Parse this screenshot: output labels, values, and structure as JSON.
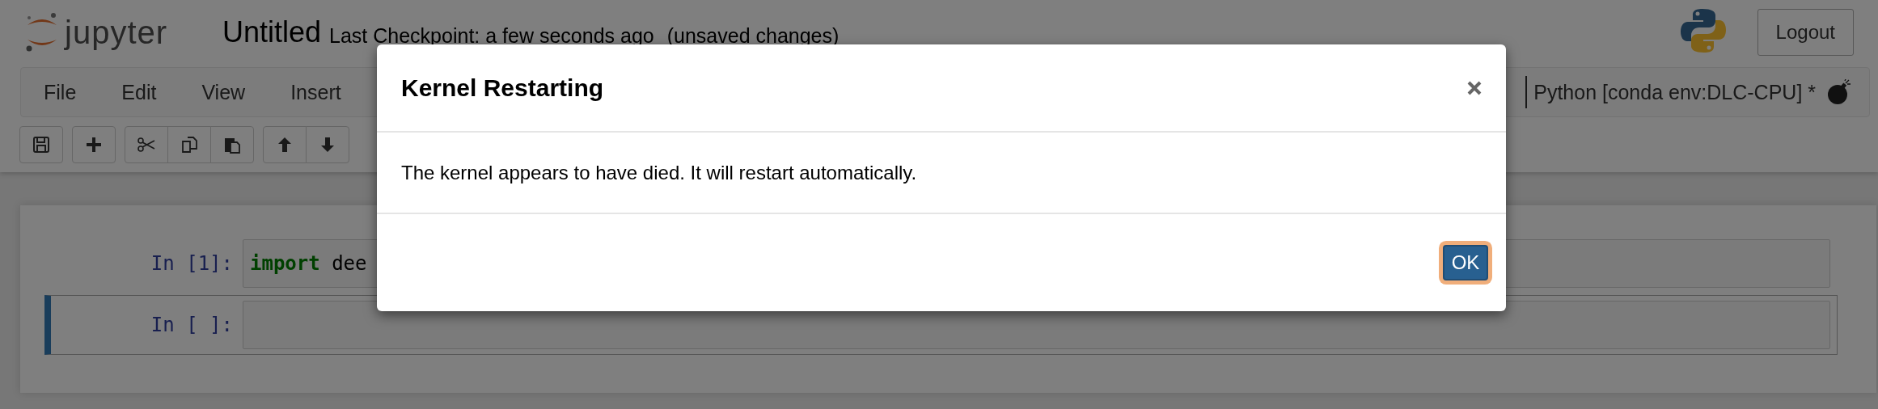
{
  "header": {
    "logo_text": "jupyter",
    "notebook_name": "Untitled",
    "checkpoint": "Last Checkpoint: a few seconds ago",
    "save_status": "(unsaved changes)",
    "logout_button": "Logout"
  },
  "menubar": {
    "items": [
      "File",
      "Edit",
      "View",
      "Insert"
    ],
    "kernel_name": "Python [conda env:DLC-CPU] *"
  },
  "toolbar": {
    "groups": [
      {
        "buttons": [
          {
            "kind": "save"
          }
        ]
      },
      {
        "buttons": [
          {
            "kind": "add"
          }
        ]
      },
      {
        "buttons": [
          {
            "kind": "cut"
          },
          {
            "kind": "copy"
          },
          {
            "kind": "paste"
          }
        ]
      },
      {
        "buttons": [
          {
            "kind": "up"
          },
          {
            "kind": "down"
          }
        ]
      }
    ]
  },
  "cells": [
    {
      "prompt": "In [1]:",
      "selected": false,
      "code": [
        {
          "kind": "keyword",
          "text": "import"
        },
        {
          "kind": "plain",
          "text": " dee"
        }
      ]
    },
    {
      "prompt": "In [ ]:",
      "selected": true
    }
  ],
  "dialog": {
    "title": "Kernel Restarting",
    "message": "The kernel appears to have died. It will restart automatically.",
    "ok_button": "OK",
    "ok_focused": true
  }
}
